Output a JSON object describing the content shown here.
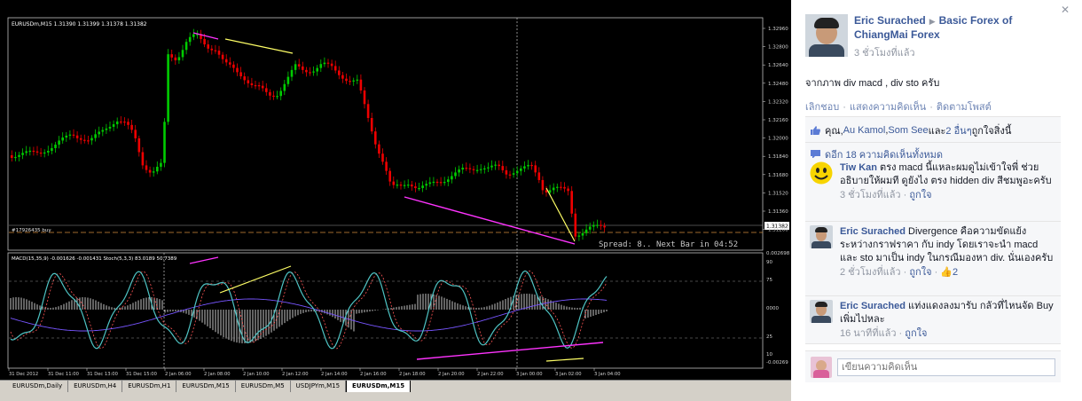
{
  "chart": {
    "main_header": "EURUSDm,M15  1.31390 1.31399 1.31378 1.31382",
    "order_label": "#17926435 buy",
    "spread_text": "Spread: 8.. Next Bar in 04:52",
    "current_price": "1.31382",
    "price_ticks": [
      "1.32960",
      "1.32800",
      "1.32640",
      "1.32480",
      "1.32320",
      "1.32160",
      "1.32000",
      "1.31840",
      "1.31680",
      "1.31520",
      "1.31360",
      "1.31200"
    ],
    "indicator_header": "MACD(15,35,9) -0.001626 -0.001431  Stoch(5,3,3) 83.0189 50.7389",
    "indicator_ticks": [
      "0.002698",
      "90",
      "75",
      "0000",
      "25",
      "10",
      "-0.00269"
    ],
    "time_ticks": [
      "31 Dec 2012",
      "31 Dec 11:00",
      "31 Dec 13:00",
      "31 Dec 15:00",
      "2 Jan 06:00",
      "2 Jan 08:00",
      "2 Jan 10:00",
      "2 Jan 12:00",
      "2 Jan 14:00",
      "2 Jan 16:00",
      "2 Jan 18:00",
      "2 Jan 20:00",
      "2 Jan 22:00",
      "3 Jan 00:00",
      "3 Jan 02:00",
      "3 Jan 04:00"
    ],
    "colors": {
      "bull": "#00cc00",
      "bear": "#ee0000",
      "magenta": "#ff33ff",
      "yellow": "#ffff66",
      "stoch": "#4ec4c4",
      "signal": "#ff5555",
      "macd": "#7755ff"
    }
  },
  "tabs": [
    {
      "label": "EURUSDm,Daily",
      "active": false
    },
    {
      "label": "EURUSDm,H4",
      "active": false
    },
    {
      "label": "EURUSDm,H1",
      "active": false
    },
    {
      "label": "EURUSDm,M15",
      "active": false
    },
    {
      "label": "EURUSDm,M5",
      "active": false
    },
    {
      "label": "USDJPYm,M15",
      "active": false
    },
    {
      "label": "EURUSDm,M15",
      "active": true
    }
  ],
  "post": {
    "author": "Eric Surached",
    "group": "Basic Forex of ChiangMai Forex",
    "time": "3 ชั่วโมงที่แล้ว",
    "body": "จากภาพ div macd , div sto ครับ",
    "actions": [
      "เลิกชอบ",
      "แสดงความคิดเห็น",
      "ติดตามโพสต์"
    ],
    "likes_prefix": "คุณ, ",
    "likes_user1": "Au Kamol",
    "likes_sep": ", ",
    "likes_user2": "Som See",
    "likes_and": " และ ",
    "likes_others": "2 อื่นๆ",
    "likes_suffix": " ถูกใจสิ่งนี้",
    "view_all": "ดูอีก 18 ความคิดเห็นทั้งหมด"
  },
  "comments": [
    {
      "name": "Tiw Kan",
      "text": "ตรง macd นี้แหละผมดูไม่เข้าใจพี่ ช่วยอธิบายให้ผมที ดูยังไง ตรง hidden div สีชมพูอะครับ",
      "time": "3 ชั่วโมงที่แล้ว",
      "like": "ถูกใจ",
      "count": ""
    },
    {
      "name": "Eric Surached",
      "text": "Divergence คือความขัดแย้งระหว่างกราฟราคา กับ indy โดยเราจะนำ macd และ sto มาเป็น indy ในกรณีมองหา div. นั่นเองครับ",
      "time": "2 ชั่วโมงที่แล้ว",
      "like": "ถูกใจ",
      "count": "2"
    },
    {
      "name": "Eric Surached",
      "text": "แท่งแดงลงมารับ กลัวที่ไหนจัด Buy เพิ่มไปหละ",
      "time": "16 นาทีที่แล้ว",
      "like": "ถูกใจ",
      "count": ""
    }
  ],
  "write_placeholder": "เขียนความคิดเห็น"
}
